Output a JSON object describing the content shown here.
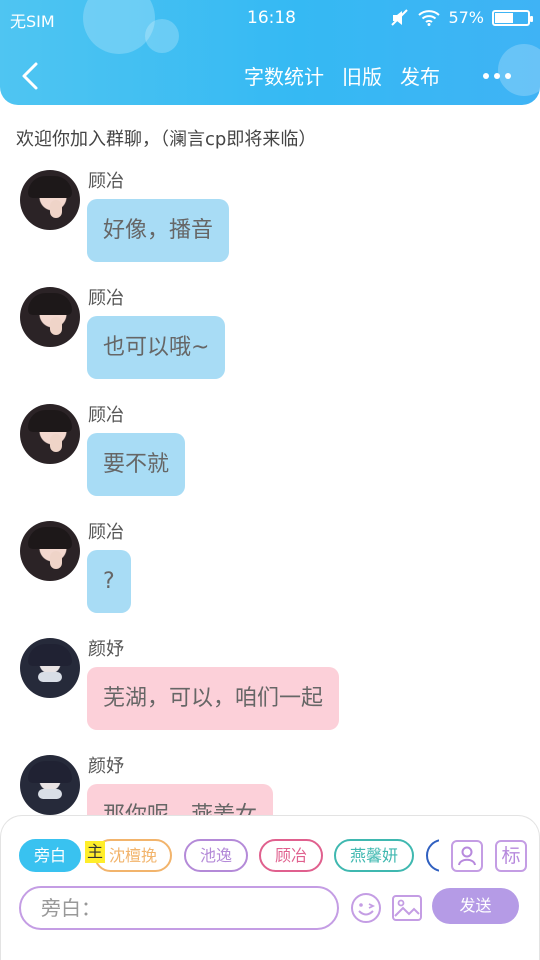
{
  "status_bar": {
    "carrier": "无SIM",
    "time": "16:18",
    "battery": "57%",
    "battery_level": 0.57
  },
  "nav": {
    "back_icon": "chevron-left-icon",
    "actions": [
      "字数统计",
      "旧版",
      "发布"
    ],
    "more_icon": "more-dots-icon"
  },
  "welcome": "欢迎你加入群聊，（澜言cp即将来临）",
  "messages": [
    {
      "name": "顾冶",
      "text": "好像，播音",
      "style": "blue"
    },
    {
      "name": "顾冶",
      "text": "也可以哦~",
      "style": "blue"
    },
    {
      "name": "顾冶",
      "text": "要不就",
      "style": "blue"
    },
    {
      "name": "顾冶",
      "text": "?",
      "style": "blue"
    },
    {
      "name": "颜妤",
      "text": "芜湖，可以，咱们一起",
      "style": "pink"
    },
    {
      "name": "颜妤",
      "text": "那你呢，燕姜女",
      "style": "pink"
    }
  ],
  "composer": {
    "roles": [
      {
        "label": "旁白",
        "color": "#39c2f0",
        "active": true
      },
      {
        "label": "沈檀挽",
        "color": "#f2b46c"
      },
      {
        "label": "池逸",
        "color": "#b48ad8"
      },
      {
        "label": "顾冶",
        "color": "#e0608e"
      },
      {
        "label": "燕馨妍",
        "color": "#3fb8b0"
      },
      {
        "label": "",
        "color": "#3060c0"
      }
    ],
    "main_tag": "主",
    "person_icon": "person-card-icon",
    "tag_button": "标",
    "input_placeholder": "旁白：",
    "emoji_icon": "emoji-icon",
    "image_icon": "image-icon",
    "send_label": "发送",
    "accent": "#b59be6"
  }
}
